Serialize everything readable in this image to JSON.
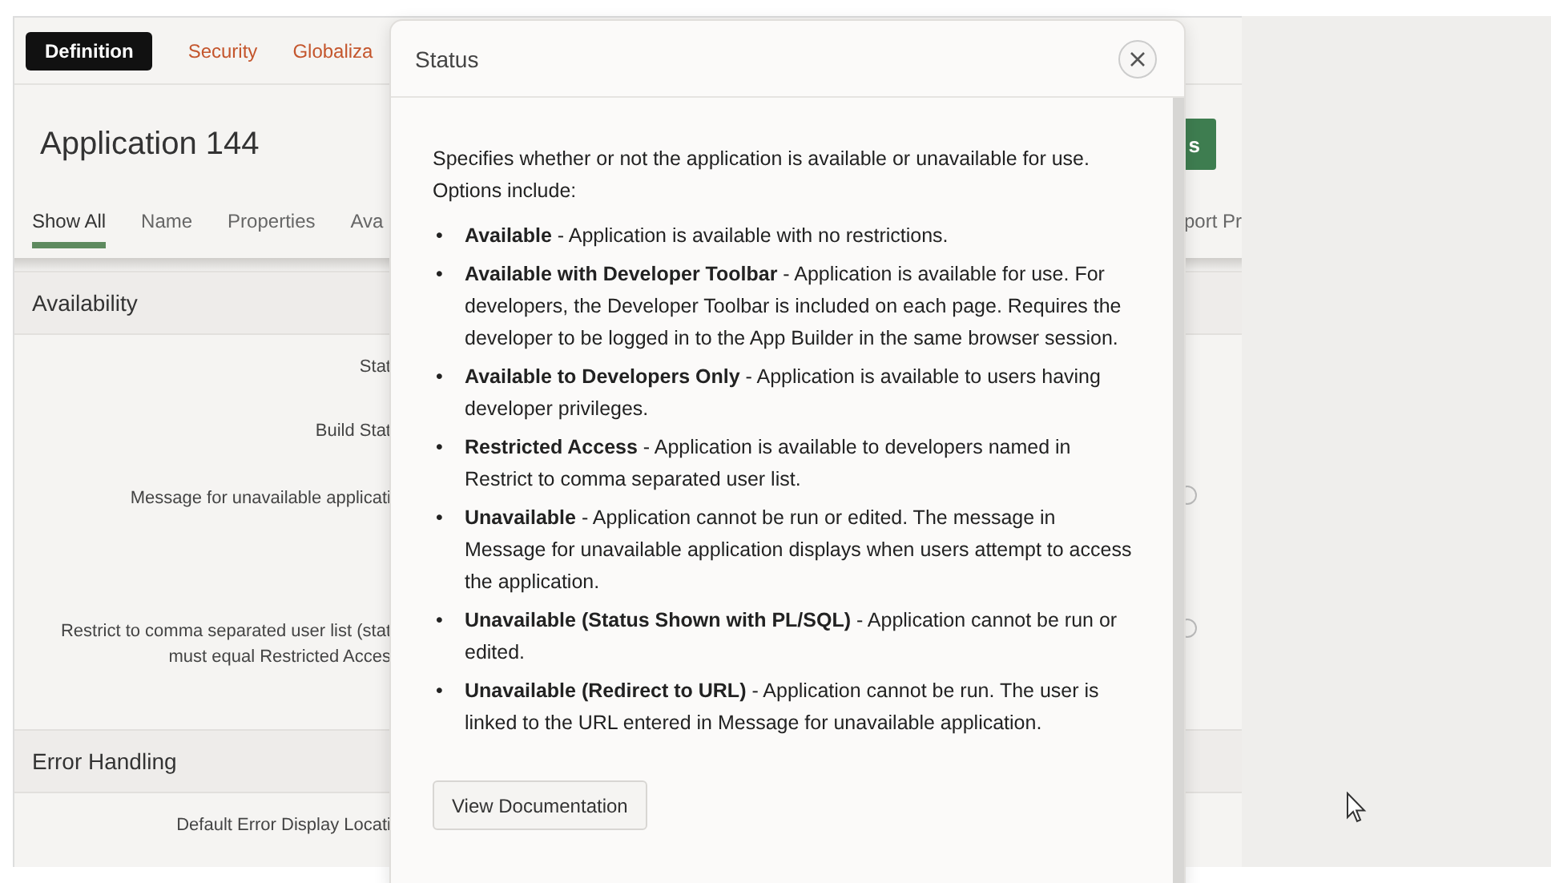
{
  "tabs": [
    {
      "label": "Definition",
      "selected": true
    },
    {
      "label": "Security",
      "selected": false
    },
    {
      "label": "Globaliza",
      "selected": false
    }
  ],
  "page_title": "Application 144",
  "primary_button": {
    "label": "s"
  },
  "subtabs": [
    {
      "label": "Show All",
      "selected": true
    },
    {
      "label": "Name",
      "selected": false
    },
    {
      "label": "Properties",
      "selected": false
    },
    {
      "label": "Ava",
      "selected": false
    }
  ],
  "subtabs_right": [
    {
      "label": "port Pr",
      "selected": false
    }
  ],
  "sections": [
    {
      "title": "Availability",
      "rows": [
        {
          "label": "Stat",
          "help": false
        },
        {
          "label": "Build Stat",
          "help": false
        },
        {
          "label": "Message for unavailable applicati",
          "help": true
        },
        {
          "label": "Restrict to comma separated user list (stat\nmust equal Restricted Acces",
          "help": true
        }
      ]
    },
    {
      "title": "Error Handling",
      "rows": [
        {
          "label": "Default Error Display Locati",
          "help": false
        }
      ]
    }
  ],
  "popup": {
    "title": "Status",
    "intro": "Specifies whether or not the application is available or unavailable for use. Options include:",
    "options": [
      {
        "bullet": "•",
        "text": "**Available** - Application is available with no restrictions."
      },
      {
        "bullet": "•",
        "text": "**Available with Developer Toolbar** - Application is available for use. For developers, the Developer Toolbar is included on each page. Requires the developer to be logged in to the App Builder in the same browser session."
      },
      {
        "bullet": "•",
        "text": "**Available to Developers Only** - Application is available to users having developer privileges."
      },
      {
        "bullet": "•",
        "text": "**Restricted Access** - Application is available to developers named in Restrict to comma separated user list."
      },
      {
        "bullet": "•",
        "text": "**Unavailable** - Application cannot be run or edited. The message in Message for unavailable application displays when users attempt to access the application."
      },
      {
        "bullet": "•",
        "text": "**Unavailable (Status Shown with PL/SQL)** - Application cannot be run or edited."
      },
      {
        "bullet": "•",
        "text": "**Unavailable (Redirect to URL)** - Application cannot be run. The user is linked to the URL entered in Message for unavailable application."
      }
    ],
    "button": "View Documentation"
  }
}
